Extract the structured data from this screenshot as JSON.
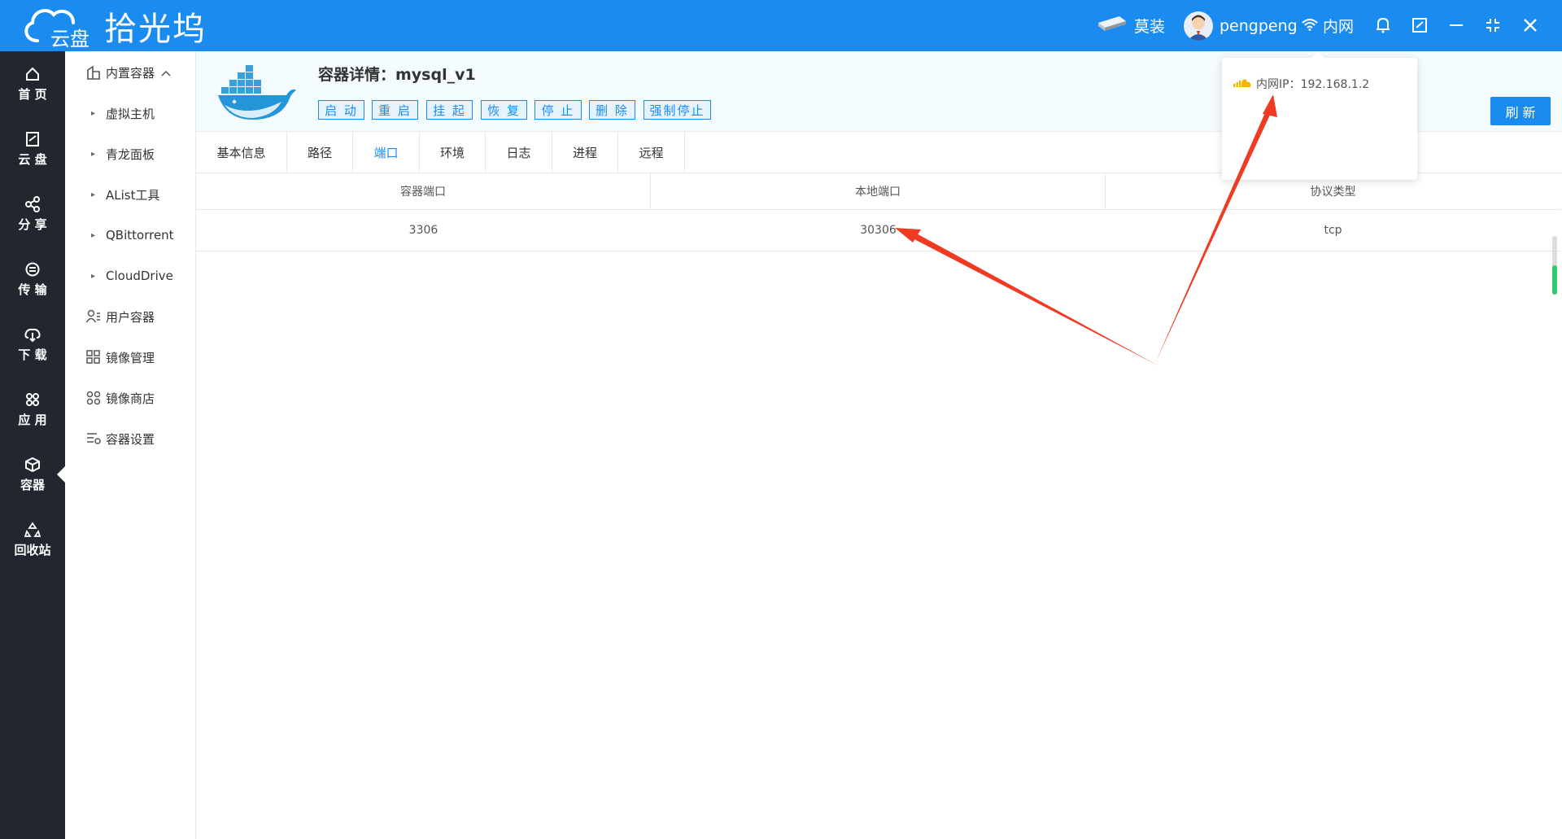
{
  "app": {
    "logo_sub": "云盘",
    "logo_title": "拾光坞",
    "device_label": "莫装",
    "user_name": "pengpeng",
    "network_label": "内网"
  },
  "left_nav": [
    {
      "label": "首 页",
      "icon": "home-icon"
    },
    {
      "label": "云 盘",
      "icon": "cloud-disk-icon"
    },
    {
      "label": "分 享",
      "icon": "share-icon"
    },
    {
      "label": "传 输",
      "icon": "transfer-icon"
    },
    {
      "label": "下 载",
      "icon": "download-icon"
    },
    {
      "label": "应 用",
      "icon": "apps-icon"
    },
    {
      "label": "容器",
      "icon": "container-icon"
    },
    {
      "label": "回收站",
      "icon": "recycle-icon"
    }
  ],
  "sub_nav": {
    "group_label": "内置容器",
    "builtin": [
      "虚拟主机",
      "青龙面板",
      "AList工具",
      "QBittorrent",
      "CloudDrive"
    ],
    "others": [
      {
        "label": "用户容器",
        "icon": "user-container-icon"
      },
      {
        "label": "镜像管理",
        "icon": "image-manage-icon"
      },
      {
        "label": "镜像商店",
        "icon": "image-store-icon"
      },
      {
        "label": "容器设置",
        "icon": "container-settings-icon"
      }
    ]
  },
  "detail": {
    "title": "容器详情：mysql_v1",
    "buttons": [
      "启 动",
      "重 启",
      "挂 起",
      "恢 复",
      "停 止",
      "删 除",
      "强制停止"
    ],
    "refresh_label": "刷 新"
  },
  "tabs": [
    "基本信息",
    "路径",
    "端口",
    "环境",
    "日志",
    "进程",
    "远程"
  ],
  "active_tab": "端口",
  "port_table": {
    "headers": [
      "容器端口",
      "本地端口",
      "协议类型"
    ],
    "rows": [
      [
        "3306",
        "30306",
        "tcp"
      ]
    ]
  },
  "popover": {
    "text": "内网IP：192.168.1.2"
  },
  "colors": {
    "primary": "#1a8cf0",
    "sidebar_dark": "#22262f",
    "annotation_arrow": "#f03a22"
  }
}
